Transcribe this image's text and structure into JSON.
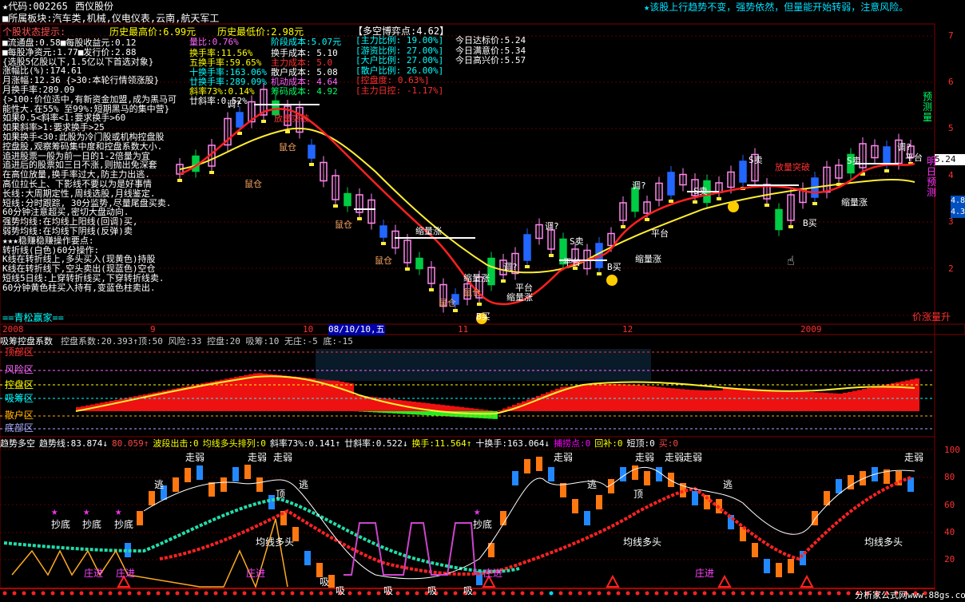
{
  "header": {
    "code_label": "★代码:002265",
    "stock_name": "西仪股份",
    "sector": "■所属板块:汽车类,机械,仪电仪表,云南,航天军工",
    "headline": "★该股上行趋势不变，强势依然，但量能开始转弱，注意风险。",
    "status_title": "个股状态提示:",
    "hist_high": "历史最高价:6.99元",
    "hist_low": "历史最低价:2.98元"
  },
  "info_lines": [
    "■流通盘:0.58■每股收益元:0.12",
    "■每股净资元:1.77■发行价:2.88",
    "{选股5亿股以下,1.5亿以下首选对象}",
    "涨幅比(%):174.61",
    "月涨幅:12.36  {>30:本轮行情领涨股}",
    "月换手率:289.09",
    "{>100:价位适中,有新资金加盟,成为黑马可",
    "能性大.在55% 至99%:短期黑马的集中营}",
    "如果0.5<斜率<1:要求换手>60",
    "如果斜率>1:要求换手>25",
    "如果换手<30:此股为冷门股或机构控盘股",
    "控盘股,观察筹码集中度和控盘系数大小.",
    "追进股票一般为前一日的1-2倍量为宜",
    "追进后的股票如三日不涨,则抛出免深套",
    "在高位放量,换手率过大,防主力出逃.",
    "高位拉长上、下影线不要以为是好事情",
    "长线:大周期定性,周线选股,月线鉴定.",
    "短线:分时跟踪, 30分监势,尽量尾盘买卖.",
    "60分钟注意超买,密切大盘动向.",
    "强势均线:在均线上阳线(回调)买,",
    "弱势均线:在均线下阴线(反弹)卖",
    "★★★稳赚稳赚操作要点:",
    "转折线(白色)60分操作:",
    "K线在转折线上,多头买入(现黄色)持股",
    "K线在转折线下,空头卖出(现蓝色)空仓",
    "短线5日线:上穿转折线买,下穿转折线卖.",
    "60分钟黄色柱买入持有,变蓝色柱卖出."
  ],
  "signature": "==青松赢家==",
  "turnover_block": {
    "liangbi": "量比:0.76%",
    "huanshou": "换手率:11.56%",
    "five": "五换手率:59.65%",
    "ten": "十换手率:163.06%",
    "twenty": "廿换手率:289.09%",
    "slope73": "斜率73%:0.14%",
    "slope20": "廿斜率:0.52%",
    "stage_cost": "阶段成本:5.07元",
    "hs_cost": "换手成本: 5.10",
    "main_cost": "主力成本: 5.0",
    "sanhu_cost": "散户成本: 5.08",
    "jd_cost": "机动成本: 4.64",
    "chip_cost": "筹码成本: 4.92"
  },
  "ratio_block": {
    "title": "【多空博弈点:4.62】",
    "rows": [
      "[主力比例: 19.00%]",
      "[游资比例: 27.00%]",
      "[大户比例: 27.00%]",
      "[散户比例: 26.00%]",
      "[控盘度:   0.63%]",
      "[主力日控: -1.17%]"
    ],
    "targets": [
      "今日达标价:5.24",
      "今日满意价:5.34",
      "今日高兴价:5.57"
    ]
  },
  "y_axis": [
    "7",
    "6",
    "5",
    "4",
    "3",
    "2"
  ],
  "price_tags": [
    "5.24",
    "4.8",
    "4.3"
  ],
  "side_labels": {
    "predict_up": "预测量",
    "predict_tomorrow": "明日预测",
    "price_up": "价涨量升"
  },
  "x_axis": {
    "labels": [
      "2008",
      "9",
      "10",
      "08/10/10,五",
      "11",
      "12",
      "2009"
    ]
  },
  "kline_annotations": [
    "鼠仓",
    "鼠仓",
    "鼠仓",
    "鼠仓",
    "鼠仓",
    "鼠仓",
    "缩量涨",
    "缩量涨",
    "缩量涨",
    "缩量涨",
    "调?",
    "调?",
    "调?",
    "调?",
    "S卖",
    "S卖",
    "S卖",
    "S卖",
    "B买",
    "B买",
    "B买",
    "平台",
    "平台",
    "平台",
    "平台",
    "缩量涨",
    "放量突破",
    "放量突破",
    "调?"
  ],
  "panel2": {
    "title": "吸筹控盘系数",
    "values": "控盘系数:20.393↑顶:50 风险:33 控盘:20 吸筹:10 无庄:-5 底:-15",
    "zones": [
      "顶部区",
      "风险区",
      "控盘区",
      "吸筹区",
      "散户区",
      "底部区"
    ],
    "zone_colors": [
      "#ff3030",
      "#ff66ff",
      "#ffff00",
      "#00ffff",
      "#ffaa00",
      "#aaaaff"
    ]
  },
  "panel3": {
    "items": [
      {
        "t": "趋势多空",
        "c": "#ffffff"
      },
      {
        "t": "趋势线:83.874↓",
        "c": "#ffffff"
      },
      {
        "t": "80.059↑",
        "c": "#ff4444"
      },
      {
        "t": "波段出击:0",
        "c": "#ffff00"
      },
      {
        "t": "均线多头排列:0",
        "c": "#ffff00"
      },
      {
        "t": "斜率73%:0.141↑",
        "c": "#ffffff"
      },
      {
        "t": "廿斜率:0.522↓",
        "c": "#ffffff"
      },
      {
        "t": "换手:11.564↑",
        "c": "#ffff00"
      },
      {
        "t": "十换手:163.064↓",
        "c": "#ffffff"
      },
      {
        "t": "捕捞点:0",
        "c": "#ff00ff"
      },
      {
        "t": "回补:0",
        "c": "#ffff00"
      },
      {
        "t": "短顶:0",
        "c": "#ffffff"
      },
      {
        "t": "买:0",
        "c": "#ff4444"
      }
    ],
    "labels": [
      "走弱",
      "走弱",
      "走弱",
      "走弱",
      "走弱",
      "走弱",
      "走弱",
      "走弱",
      "逃",
      "逃",
      "逃",
      "逃",
      "顶",
      "顶",
      "抄底",
      "抄底",
      "抄底",
      "抄底",
      "均线多头",
      "均线多头",
      "均线多头",
      "庄进",
      "庄进",
      "庄进",
      "庄进",
      "庄进",
      "吸",
      "吸",
      "吸",
      "吸",
      "吸"
    ],
    "right_axis": [
      "100",
      "80",
      "60",
      "40",
      "20"
    ]
  },
  "watermark": "分析家公式网www.88gs.com"
}
